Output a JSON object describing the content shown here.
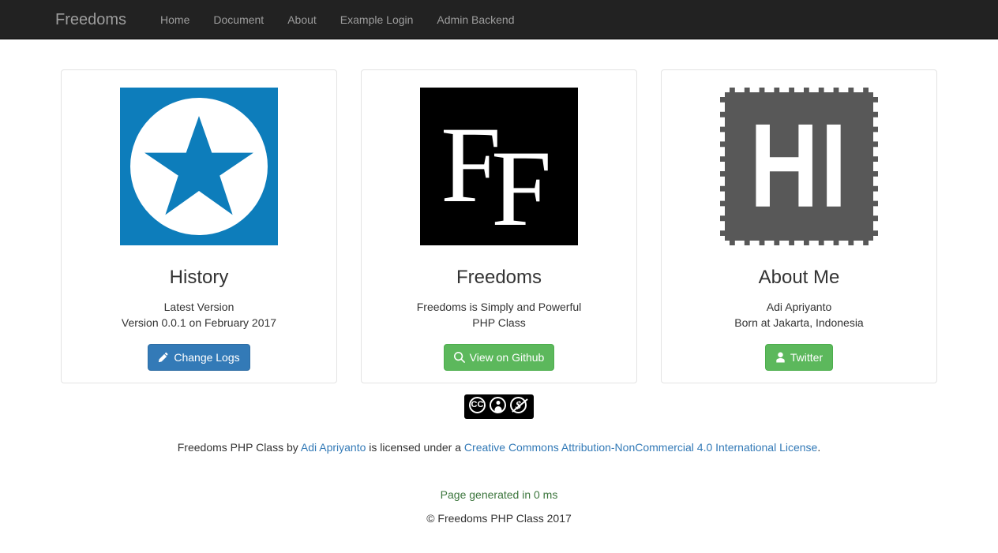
{
  "navbar": {
    "brand": "Freedoms",
    "links": [
      {
        "label": "Home"
      },
      {
        "label": "Document"
      },
      {
        "label": "About"
      },
      {
        "label": "Example Login"
      },
      {
        "label": "Admin Backend"
      }
    ]
  },
  "cards": [
    {
      "id": "history",
      "thumb_alt": "blue-star-badge",
      "title": "History",
      "line1": "Latest Version",
      "line2": "Version 0.0.1 on February 2017",
      "button_label": "Change Logs",
      "button_icon": "pencil-icon",
      "button_color": "#337ab7"
    },
    {
      "id": "freedoms",
      "thumb_alt": "double-f-logo",
      "thumb_text": "F",
      "title": "Freedoms",
      "line1": "Freedoms is Simply and Powerful",
      "line2": "PHP Class",
      "button_label": "View on Github",
      "button_icon": "search-icon",
      "button_color": "#5cb85c"
    },
    {
      "id": "about-me",
      "thumb_alt": "hi-avatar",
      "thumb_text": "HI",
      "title": "About Me",
      "line1": "Adi Apriyanto",
      "line2": "Born at Jakarta, Indonesia",
      "button_label": "Twitter",
      "button_icon": "user-icon",
      "button_color": "#5cb85c"
    }
  ],
  "footer": {
    "cc_badge": {
      "cc_text": "CC",
      "by_caption": "BY",
      "nc_caption": "NC",
      "nc_symbol": "$"
    },
    "license_prefix": "Freedoms PHP Class by ",
    "license_author": "Adi Apriyanto",
    "license_middle": " is licensed under a ",
    "license_name": "Creative Commons Attribution-NonCommercial 4.0 International License",
    "license_suffix": ".",
    "generated": "Page generated in 0 ms",
    "copyright": "© Freedoms PHP Class 2017",
    "generated_color": "#3c763d",
    "link_color": "#337ab7"
  }
}
